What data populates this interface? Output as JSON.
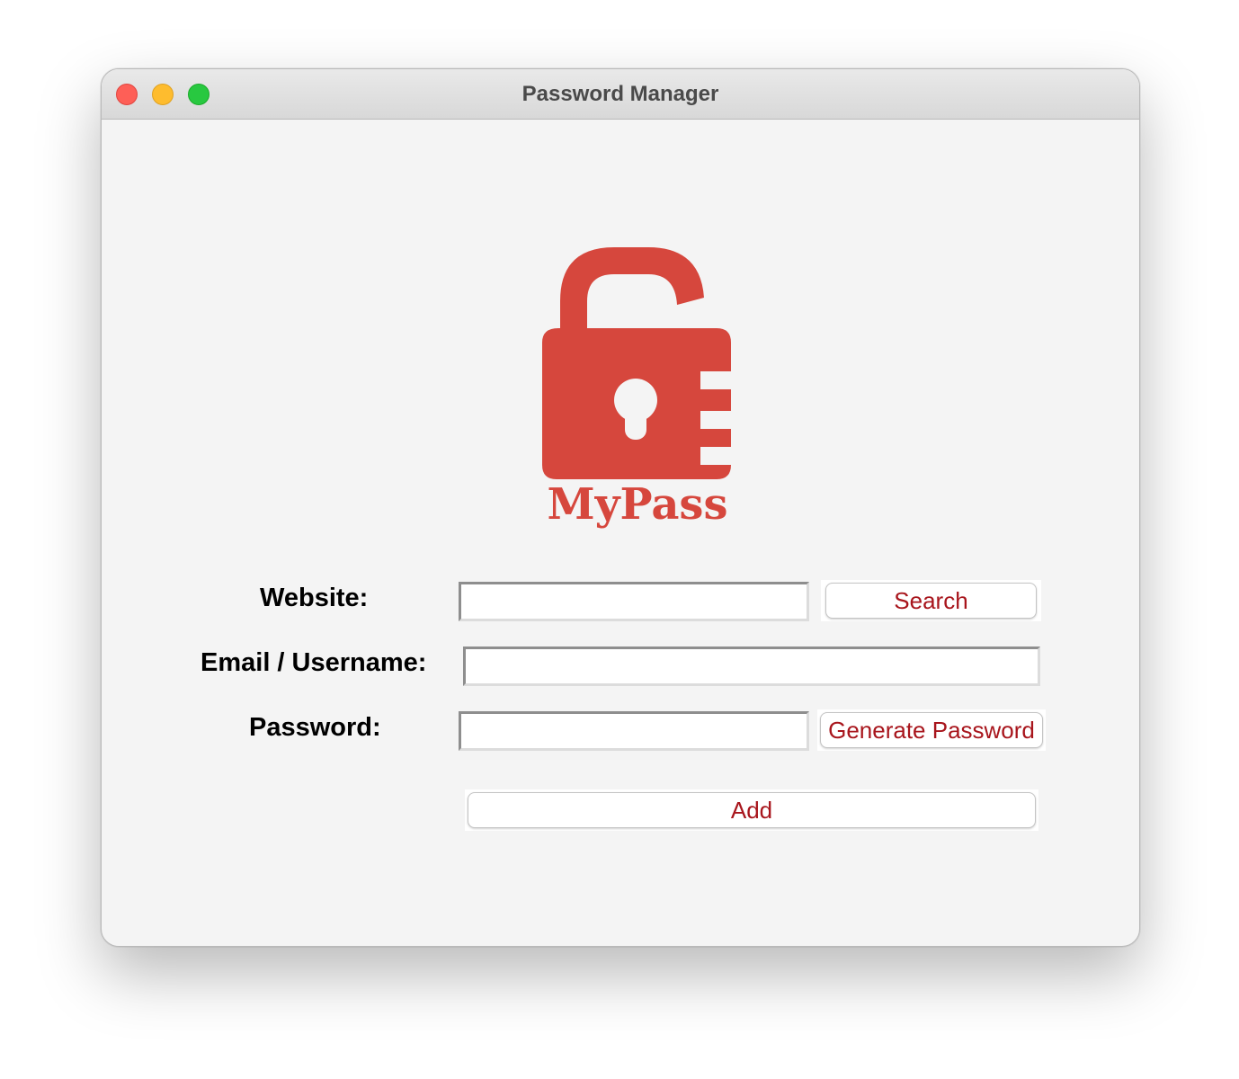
{
  "window": {
    "title": "Password Manager"
  },
  "logo": {
    "text": "MyPass",
    "icon": "unlocked-padlock-icon",
    "color": "#d6473d"
  },
  "form": {
    "website_label": "Website:",
    "website_value": "",
    "email_label": "Email / Username:",
    "email_value": "",
    "password_label": "Password:",
    "password_value": "",
    "search_button": "Search",
    "generate_button": "Generate Password",
    "add_button": "Add"
  },
  "colors": {
    "button_text": "#a8151c",
    "window_bg": "#f4f4f4"
  }
}
